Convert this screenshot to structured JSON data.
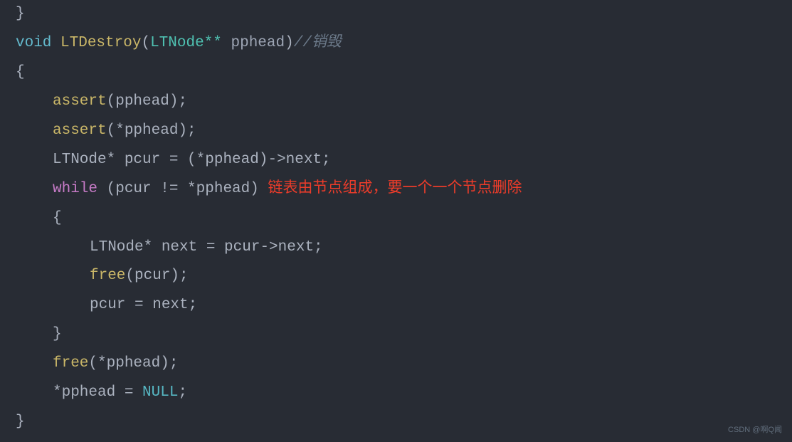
{
  "code": {
    "brace_close_top": "}",
    "sig_void": "void",
    "sig_fn": " LTDestroy",
    "sig_open": "(",
    "sig_type": "LTNode** ",
    "sig_param": "pphead",
    "sig_close": ")",
    "sig_comment": "//销毁",
    "brace_open": "{",
    "assert1_kw": "assert",
    "assert1_args": "(pphead);",
    "assert2_kw": "assert",
    "assert2_args": "(*pphead);",
    "decl_pcur": "LTNode* pcur = (*pphead)->next;",
    "while_kw": "while",
    "while_cond": " (pcur != *pphead)",
    "while_note": " 链表由节点组成，要一个一个节点删除",
    "inner_open": "{",
    "inner_decl": "LTNode* next = pcur->next;",
    "inner_free_kw": "free",
    "inner_free_args": "(pcur);",
    "inner_assign": "pcur = next;",
    "inner_close": "}",
    "free_kw": "free",
    "free_args": "(*pphead);",
    "setnull_pre": "*pphead = ",
    "setnull_null": "NULL",
    "setnull_post": ";",
    "brace_close_end": "}"
  },
  "watermark": "CSDN @啊Q闻"
}
